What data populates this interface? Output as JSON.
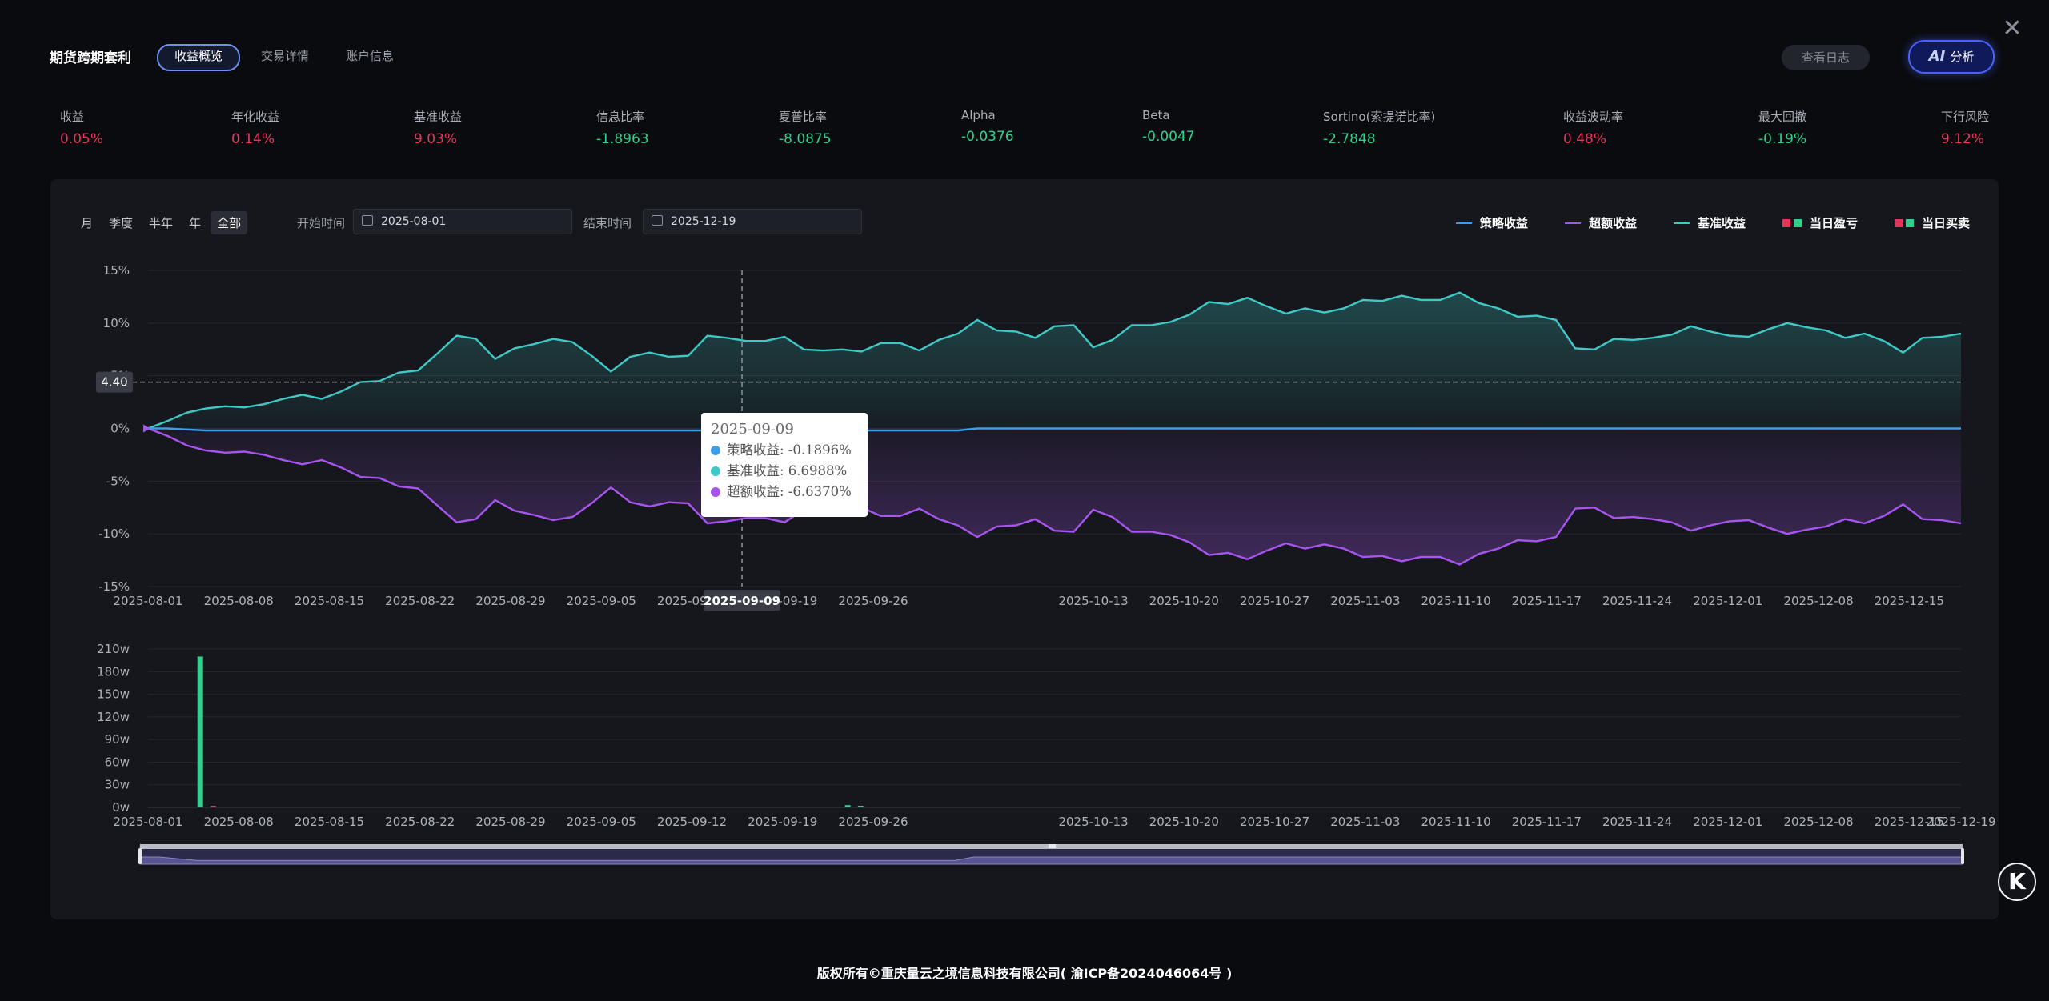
{
  "header": {
    "app_title": "期货跨期套利",
    "tabs": [
      "收益概览",
      "交易详情",
      "账户信息"
    ],
    "log_button": "查看日志",
    "ai_button_icon": "AI",
    "ai_button": "分析",
    "close_icon": "close-icon"
  },
  "metrics": [
    {
      "label": "收益",
      "value": "0.05%",
      "color": "#e8355c"
    },
    {
      "label": "年化收益",
      "value": "0.14%",
      "color": "#e8355c"
    },
    {
      "label": "基准收益",
      "value": "9.03%",
      "color": "#e8355c"
    },
    {
      "label": "信息比率",
      "value": "-1.8963",
      "color": "#2fd08e"
    },
    {
      "label": "夏普比率",
      "value": "-8.0875",
      "color": "#2fd08e"
    },
    {
      "label": "Alpha",
      "value": "-0.0376",
      "color": "#2fd08e"
    },
    {
      "label": "Beta",
      "value": "-0.0047",
      "color": "#2fd08e"
    },
    {
      "label": "Sortino(索提诺比率)",
      "value": "-2.7848",
      "color": "#2fd08e"
    },
    {
      "label": "收益波动率",
      "value": "0.48%",
      "color": "#e8355c"
    },
    {
      "label": "最大回撤",
      "value": "-0.19%",
      "color": "#2fd08e"
    },
    {
      "label": "下行风险",
      "value": "9.12%",
      "color": "#e8355c"
    }
  ],
  "controls": {
    "periods": [
      "月",
      "季度",
      "半年",
      "年",
      "全部"
    ],
    "active_period": "全部",
    "start_label": "开始时间",
    "start_date": "2025-08-01",
    "end_label": "结束时间",
    "end_date": "2025-12-19"
  },
  "legend": [
    {
      "label": "策略收益",
      "color": "#3d9de8",
      "type": "line"
    },
    {
      "label": "超额收益",
      "color": "#a855f0",
      "type": "line"
    },
    {
      "label": "基准收益",
      "color": "#3ec9c6",
      "type": "line"
    },
    {
      "label": "当日盈亏",
      "colors": [
        "#e8355c",
        "#2fd08e"
      ],
      "type": "square"
    },
    {
      "label": "当日买卖",
      "colors": [
        "#e8355c",
        "#2fd08e"
      ],
      "type": "square"
    }
  ],
  "tooltip": {
    "date": "2025-09-09",
    "rows": [
      {
        "label": "策略收益: -0.1896%",
        "color": "#3d9de8"
      },
      {
        "label": "基准收益: 6.6988%",
        "color": "#3ec9c6"
      },
      {
        "label": "超额收益: -6.6370%",
        "color": "#a855f0"
      }
    ]
  },
  "crosshair": {
    "y_label": "4.40",
    "x_label": "2025-09-09"
  },
  "chart_data": [
    {
      "type": "line",
      "title": "",
      "x_ticks": [
        "2025-08-01",
        "2025-08-08",
        "2025-08-15",
        "2025-08-22",
        "2025-08-29",
        "2025-09-05",
        "2025-09-12",
        "2025-09-19",
        "2025-09-26",
        "2025-10-13",
        "2025-10-20",
        "2025-10-27",
        "2025-11-03",
        "2025-11-10",
        "2025-11-17",
        "2025-11-24",
        "2025-12-01",
        "2025-12-08",
        "2025-12-15"
      ],
      "y_ticks": [
        "15%",
        "10%",
        "5%",
        "0%",
        "-5%",
        "-10%",
        "-15%"
      ],
      "ylim": [
        -15,
        15
      ],
      "grid": true,
      "legend_position": "top-right",
      "series": [
        {
          "name": "基准收益",
          "color": "#3ec9c6",
          "values": [
            0,
            0.7,
            1.5,
            1.9,
            2.1,
            2.0,
            2.3,
            2.8,
            3.2,
            2.8,
            3.5,
            4.4,
            4.5,
            5.3,
            5.5,
            7.1,
            8.8,
            8.5,
            6.6,
            7.6,
            8.0,
            8.5,
            8.2,
            6.9,
            5.4,
            6.8,
            7.2,
            6.8,
            6.9,
            8.8,
            8.6,
            8.3,
            8.3,
            8.7,
            7.5,
            7.4,
            7.5,
            7.3,
            8.1,
            8.1,
            7.4,
            8.4,
            9.0,
            10.3,
            9.3,
            9.2,
            8.6,
            9.7,
            9.8,
            7.7,
            8.4,
            9.8,
            9.8,
            10.1,
            10.8,
            12.0,
            11.8,
            12.4,
            11.6,
            10.9,
            11.4,
            11.0,
            11.4,
            12.2,
            12.1,
            12.6,
            12.2,
            12.2,
            12.9,
            11.9,
            11.4,
            10.6,
            10.7,
            10.3,
            7.6,
            7.5,
            8.5,
            8.4,
            8.6,
            8.9,
            9.7,
            9.2,
            8.8,
            8.7,
            9.4,
            10.0,
            9.6,
            9.3,
            8.6,
            9.0,
            8.3,
            7.2,
            8.6,
            8.7,
            9.0
          ]
        },
        {
          "name": "策略收益",
          "color": "#3d9de8",
          "values": [
            0,
            0,
            -0.1,
            -0.19,
            -0.19,
            -0.19,
            -0.19,
            -0.19,
            -0.19,
            -0.19,
            -0.19,
            -0.19,
            -0.19,
            -0.19,
            -0.19,
            -0.19,
            -0.19,
            -0.19,
            -0.19,
            -0.19,
            -0.19,
            -0.19,
            -0.19,
            -0.19,
            -0.19,
            -0.19,
            -0.19,
            -0.19,
            -0.19,
            -0.19,
            -0.19,
            -0.19,
            -0.19,
            -0.19,
            -0.19,
            -0.19,
            -0.19,
            -0.19,
            -0.19,
            -0.19,
            -0.19,
            -0.19,
            -0.19,
            0,
            0,
            0,
            0,
            0,
            0,
            0,
            0,
            0,
            0,
            0,
            0,
            0,
            0,
            0,
            0,
            0,
            0,
            0,
            0,
            0,
            0,
            0,
            0,
            0,
            0,
            0,
            0,
            0,
            0,
            0,
            0,
            0,
            0,
            0,
            0,
            0,
            0,
            0,
            0,
            0,
            0,
            0,
            0,
            0,
            0,
            0,
            0,
            0,
            0,
            0,
            0
          ]
        },
        {
          "name": "超额收益",
          "color": "#a855f0",
          "values": [
            0,
            -0.7,
            -1.6,
            -2.1,
            -2.3,
            -2.2,
            -2.5,
            -3.0,
            -3.4,
            -3.0,
            -3.7,
            -4.6,
            -4.7,
            -5.5,
            -5.7,
            -7.3,
            -8.9,
            -8.6,
            -6.8,
            -7.8,
            -8.2,
            -8.7,
            -8.4,
            -7.1,
            -5.6,
            -7.0,
            -7.4,
            -7.0,
            -7.1,
            -9.0,
            -8.8,
            -8.5,
            -8.5,
            -8.9,
            -7.7,
            -7.6,
            -7.7,
            -7.5,
            -8.3,
            -8.3,
            -7.6,
            -8.6,
            -9.2,
            -10.3,
            -9.3,
            -9.2,
            -8.6,
            -9.7,
            -9.8,
            -7.7,
            -8.4,
            -9.8,
            -9.8,
            -10.1,
            -10.8,
            -12.0,
            -11.8,
            -12.4,
            -11.6,
            -10.9,
            -11.4,
            -11.0,
            -11.4,
            -12.2,
            -12.1,
            -12.6,
            -12.2,
            -12.2,
            -12.9,
            -11.9,
            -11.4,
            -10.6,
            -10.7,
            -10.3,
            -7.6,
            -7.5,
            -8.5,
            -8.4,
            -8.6,
            -8.9,
            -9.7,
            -9.2,
            -8.8,
            -8.7,
            -9.4,
            -10.0,
            -9.6,
            -9.3,
            -8.6,
            -9.0,
            -8.3,
            -7.2,
            -8.6,
            -8.7,
            -9.0
          ]
        }
      ]
    },
    {
      "type": "bar",
      "title": "",
      "x_ticks": [
        "2025-08-01",
        "2025-08-08",
        "2025-08-15",
        "2025-08-22",
        "2025-08-29",
        "2025-09-05",
        "2025-09-12",
        "2025-09-19",
        "2025-09-26",
        "2025-10-13",
        "2025-10-20",
        "2025-10-27",
        "2025-11-03",
        "2025-11-10",
        "2025-11-17",
        "2025-11-24",
        "2025-12-01",
        "2025-12-08",
        "2025-12-15",
        "2025-12-19"
      ],
      "y_ticks": [
        "210w",
        "180w",
        "150w",
        "120w",
        "90w",
        "60w",
        "30w",
        "0w"
      ],
      "ylim": [
        0,
        210
      ],
      "series": [
        {
          "name": "当日买卖",
          "bars": [
            {
              "x": "2025-08-05",
              "value": 200,
              "color": "#2fd08e"
            },
            {
              "x": "2025-08-06",
              "value": 2,
              "color": "#e8355c"
            },
            {
              "x": "2025-09-24",
              "value": 3,
              "color": "#2fd08e"
            },
            {
              "x": "2025-09-25",
              "value": 2,
              "color": "#2fd08e"
            }
          ]
        }
      ]
    }
  ],
  "footer": "版权所有©重庆量云之境信息科技有限公司( 渝ICP备2024046064号 )",
  "k_button": "K"
}
